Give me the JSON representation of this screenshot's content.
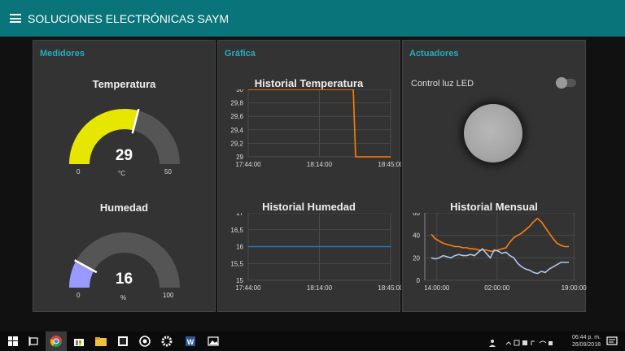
{
  "header": {
    "title": "SOLUCIONES ELECTRÓNICAS SAYM"
  },
  "cards": {
    "medidores": {
      "title": "Medidores",
      "temperatura": {
        "title": "Temperatura",
        "value": "29",
        "unit": "°C",
        "min": "0",
        "max": "50",
        "value_num": 29,
        "min_num": 0,
        "max_num": 50,
        "color": "#e6e600"
      },
      "humedad": {
        "title": "Humedad",
        "value": "16",
        "unit": "%",
        "min": "0",
        "max": "100",
        "value_num": 16,
        "min_num": 0,
        "max_num": 100,
        "color": "#9999ff"
      }
    },
    "grafica": {
      "title": "Gráfica",
      "temp_chart_title": "Historial Temperatura",
      "hum_chart_title": "Historial Humedad"
    },
    "actuadores": {
      "title": "Actuadores",
      "switch_label": "Control luz LED",
      "switch_on": false,
      "mensual_title": "Historial Mensual"
    }
  },
  "chart_data": [
    {
      "type": "line",
      "title": "Historial Temperatura",
      "x_ticks": [
        "17:44:00",
        "18:14:00",
        "18:45:00"
      ],
      "y_ticks": [
        "30",
        "29,8",
        "29,6",
        "29,4",
        "29,2",
        "29"
      ],
      "ylim": [
        29,
        30
      ],
      "series": [
        {
          "color": "#ff7f0e",
          "x": [
            "17:44:00",
            "18:29:00",
            "18:30:00",
            "18:45:00"
          ],
          "values": [
            30,
            30,
            29,
            29
          ]
        }
      ]
    },
    {
      "type": "line",
      "title": "Historial Humedad",
      "x_ticks": [
        "17:44:00",
        "18:14:00",
        "18:45:00"
      ],
      "y_ticks": [
        "17",
        "16,5",
        "16",
        "15,5",
        "15"
      ],
      "ylim": [
        15,
        17
      ],
      "series": [
        {
          "color": "#1f77b4",
          "x": [
            "17:44:00",
            "18:45:00"
          ],
          "values": [
            16,
            16
          ]
        }
      ]
    },
    {
      "type": "line",
      "title": "Historial Mensual",
      "x_ticks": [
        "14:00:00",
        "02:00:00",
        "19:00:00"
      ],
      "y_ticks": [
        "60",
        "40",
        "20",
        "0"
      ],
      "ylim": [
        0,
        60
      ],
      "series": [
        {
          "color": "#ff7f0e",
          "values": [
            41,
            37,
            35,
            33,
            32,
            31,
            30,
            30,
            29,
            29,
            28,
            28,
            27,
            27,
            27,
            26,
            26,
            27,
            28,
            29,
            34,
            38,
            40,
            42,
            45,
            48,
            52,
            55,
            52,
            47,
            42,
            37,
            33,
            31,
            30,
            30
          ]
        },
        {
          "color": "#aec7e8",
          "values": [
            20,
            19,
            20,
            22,
            21,
            20,
            22,
            23,
            22,
            22,
            23,
            22,
            25,
            28,
            24,
            20,
            27,
            26,
            24,
            25,
            22,
            20,
            15,
            12,
            10,
            9,
            7,
            6,
            8,
            7,
            10,
            12,
            14,
            16,
            16,
            16
          ]
        }
      ]
    }
  ],
  "taskbar": {
    "time": "06:44 p. m.",
    "date": "26/09/2018"
  }
}
